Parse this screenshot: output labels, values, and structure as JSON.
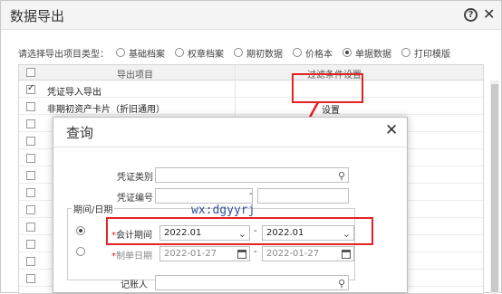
{
  "outer": {
    "title": "数据导出",
    "help_icon": "?",
    "close_icon": "✕"
  },
  "export_type": {
    "label": "请选择导出项目类型：",
    "options": [
      "基础档案",
      "权章档案",
      "期初数据",
      "价格本",
      "单据数据",
      "打印模版"
    ],
    "selected": "单据数据"
  },
  "table": {
    "col_project": "导出项目",
    "col_filter": "过滤条件设置",
    "rows": [
      {
        "label": "凭证导入导出",
        "checked": true
      },
      {
        "label": "非期初资产卡片（折旧通用）",
        "checked": false
      }
    ],
    "settings_link": "设置"
  },
  "dialog": {
    "title": "查询",
    "close_icon": "✕",
    "voucher_type_label": "凭证类别",
    "voucher_type_value": "",
    "voucher_no_label": "凭证编号",
    "voucher_no_from": "",
    "voucher_no_to": "",
    "period_group_title": "期间/日期",
    "accounting_period_label": "会计期间",
    "accounting_period_from": "2022.01",
    "accounting_period_to": "2022.01",
    "document_date_label": "制单日期",
    "document_date_from": "2022-01-27",
    "document_date_to": "2022-01-27",
    "bookkeeper_label": "记账人",
    "bookkeeper_value": "",
    "dash": "-",
    "required_mark": "*"
  },
  "watermark": "wx:dgyyrj",
  "colors": {
    "highlight": "#e52222",
    "watermark": "#3050a0"
  }
}
